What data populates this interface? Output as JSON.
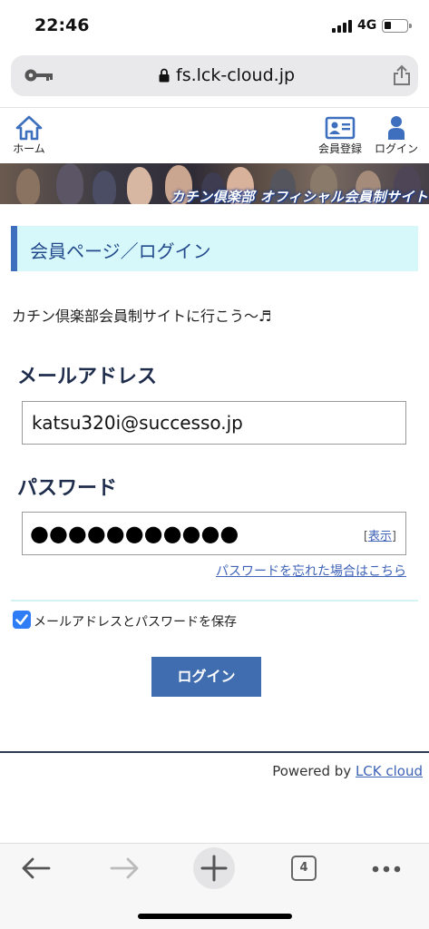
{
  "status_bar": {
    "time": "22:46",
    "network": "4G",
    "battery_level": 0.3,
    "signal_bars": 4
  },
  "url_bar": {
    "url": "fs.lck-cloud.jp",
    "key_icon": "key-icon",
    "lock_icon": "lock-icon",
    "share_icon": "share-icon"
  },
  "header": {
    "home_label": "ホーム",
    "register_label": "会員登録",
    "login_label": "ログイン",
    "accent_color": "#3d6fbe"
  },
  "banner": {
    "text": "カチン倶楽部 オフィシャル会員制サイト"
  },
  "main": {
    "heading": "会員ページ／ログイン",
    "intro": "カチン倶楽部会員制サイトに行こう〜♬",
    "email_label": "メールアドレス",
    "email_value": "katsu320i@successo.jp",
    "password_label": "パスワード",
    "password_masked": "●●●●●●●●●●●",
    "show_bracket_open": "[",
    "show_label": "表示",
    "show_bracket_close": "]",
    "forgot_link": "パスワードを忘れた場合はこちら",
    "remember_label": "メールアドレスとパスワードを保存",
    "remember_checked": true,
    "login_button": "ログイン"
  },
  "footer": {
    "powered_prefix": "Powered by ",
    "powered_link": "LCK cloud"
  },
  "toolbar": {
    "tab_count": "4",
    "back_icon": "back-arrow-icon",
    "forward_icon": "forward-arrow-icon",
    "new_tab_icon": "plus-icon",
    "menu_icon": "more-dots-icon"
  }
}
